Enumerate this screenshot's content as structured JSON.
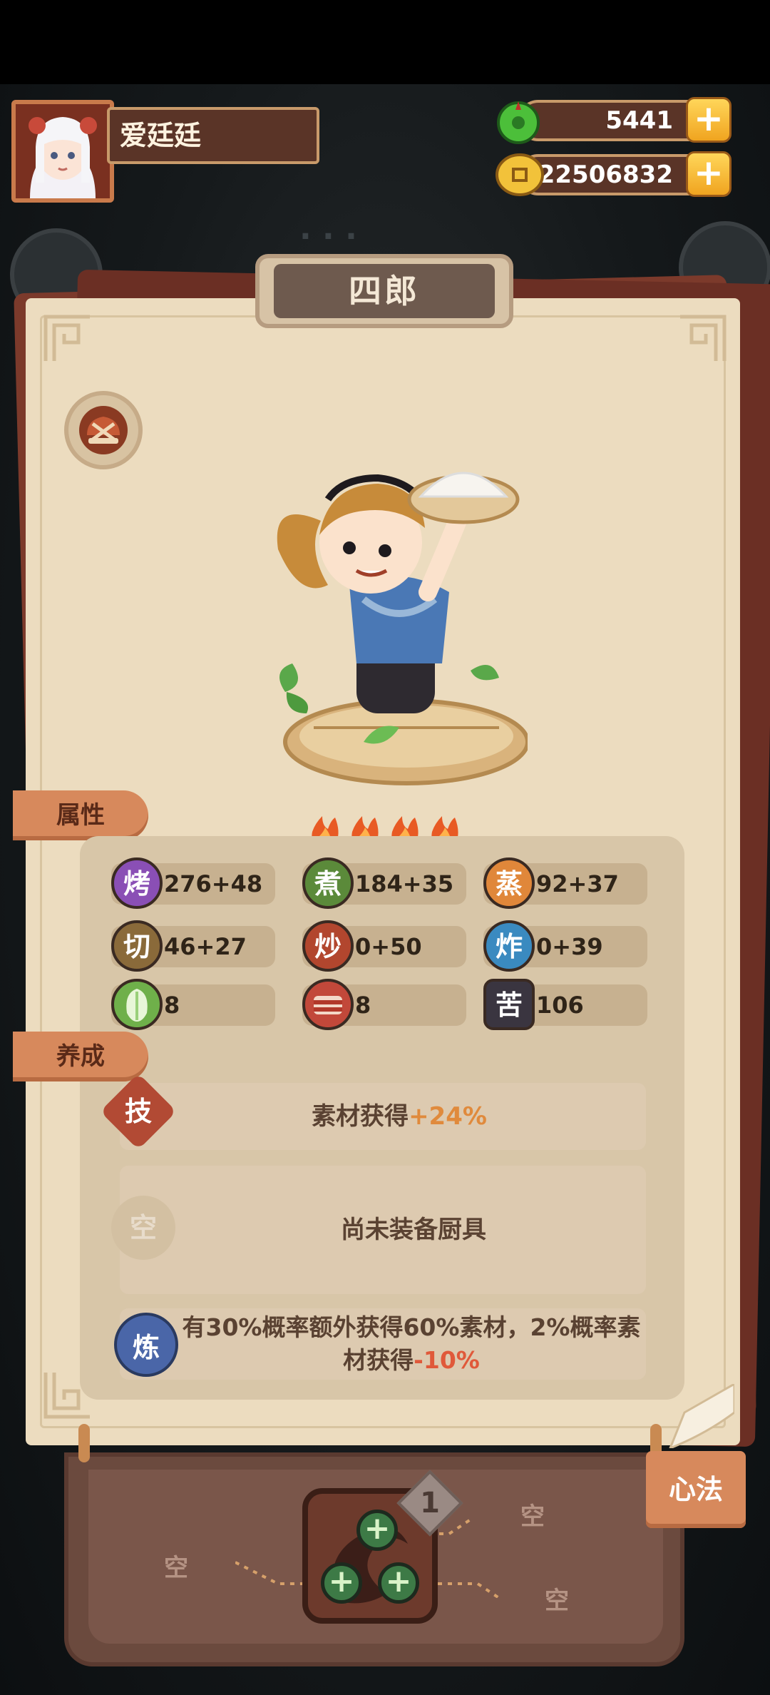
{
  "player": {
    "name": "爱廷廷"
  },
  "currency": [
    {
      "icon": "jade-icon",
      "value": "5441"
    },
    {
      "icon": "coin-icon",
      "value": "22506832"
    }
  ],
  "chef": {
    "name": "四郎",
    "stars": 4
  },
  "sections": {
    "attributes": "属性",
    "development": "养成"
  },
  "stats": [
    {
      "char": "烤",
      "value": "276+48",
      "color": "#8a4fb5"
    },
    {
      "char": "煮",
      "value": "184+35",
      "color": "#5b8a3a"
    },
    {
      "char": "蒸",
      "value": "92+37",
      "color": "#e0873a"
    },
    {
      "char": "切",
      "value": "46+27",
      "color": "#8a6a3a"
    },
    {
      "char": "炒",
      "value": "0+50",
      "color": "#b2462e"
    },
    {
      "char": "炸",
      "value": "0+39",
      "color": "#3a8ac0"
    },
    {
      "char": "",
      "value": "8",
      "color": "#6fb04a",
      "icon": "vegetable-icon"
    },
    {
      "char": "",
      "value": "8",
      "color": "#c2483a",
      "icon": "meat-icon"
    },
    {
      "char": "苦",
      "value": "106",
      "color": "#3a3540"
    }
  ],
  "skill": {
    "icon_char": "技",
    "text": "素材获得",
    "bonus": "+24%"
  },
  "equipment": {
    "icon_char": "空",
    "text": "尚未装备厨具"
  },
  "refine": {
    "icon_char": "炼",
    "text": "有30%概率额外获得60%素材，2%概率素材获得",
    "penalty": "-10%"
  },
  "xinfa": {
    "label": "心法",
    "slot_number": "1",
    "empty_label": "空"
  },
  "colors": {
    "accent": "#d7895c",
    "paper": "#ecdcbf",
    "brand_brown": "#5a3427"
  }
}
